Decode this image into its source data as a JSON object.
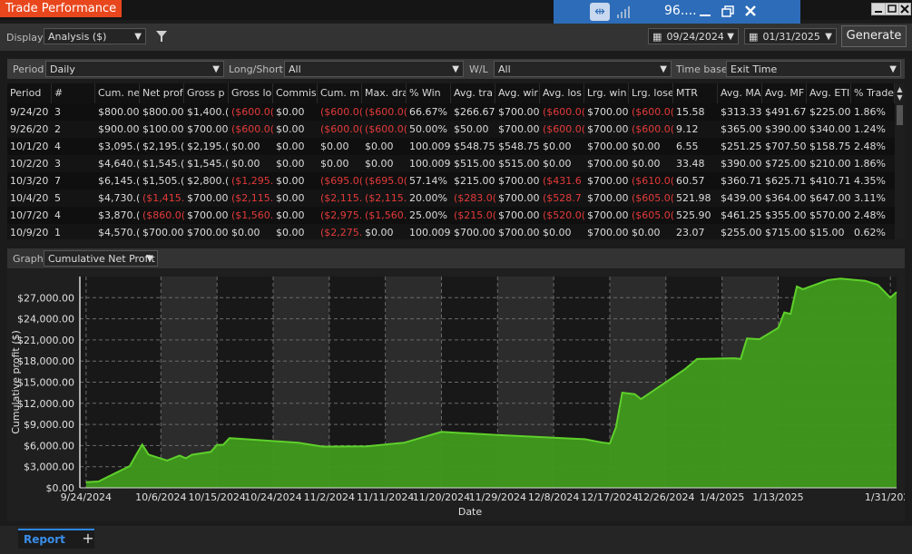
{
  "window": {
    "title": "Trade Performance"
  },
  "taskbar": {
    "label": "96...."
  },
  "toolbar": {
    "display_label": "Display",
    "display_value": "Analysis ($)",
    "start_date": "09/24/2024",
    "end_date": "01/31/2025",
    "generate_label": "Generate"
  },
  "filters": {
    "period_label": "Period",
    "period_value": "Daily",
    "longshort_label": "Long/Short",
    "longshort_value": "All",
    "wl_label": "W/L",
    "wl_value": "All",
    "timebase_label": "Time base",
    "timebase_value": "Exit Time"
  },
  "table": {
    "columns": [
      "Period",
      "#",
      "Cum. ne",
      "Net prof",
      "Gross p",
      "Gross lo",
      "Commis",
      "Cum. m",
      "Max. dra",
      "% Win",
      "Avg. tra",
      "Avg. wir",
      "Avg. los",
      "Lrg. win",
      "Lrg. lose",
      "MTR",
      "Avg. MA",
      "Avg. MF",
      "Avg. ETI",
      "% Trade"
    ],
    "rows": [
      [
        "9/24/20",
        "3",
        "$800.00",
        "$800.00",
        "$1,400.(",
        "($600.0(",
        "$0.00",
        "($600.0(",
        "($600.0(",
        "66.67%",
        "$266.67",
        "$700.00",
        "($600.0(",
        "$700.00",
        "($600.0(",
        "15.58",
        "$313.33",
        "$491.67",
        "$225.00",
        "1.86%"
      ],
      [
        "9/26/20",
        "2",
        "$900.00",
        "$100.00",
        "$700.00",
        "($600.0(",
        "$0.00",
        "($600.0(",
        "($600.0(",
        "50.00%",
        "$50.00",
        "$700.00",
        "($600.0(",
        "$700.00",
        "($600.0(",
        "9.12",
        "$365.00",
        "$390.00",
        "$340.00",
        "1.24%"
      ],
      [
        "10/1/20",
        "4",
        "$3,095.(",
        "$2,195.(",
        "$2,195.(",
        "$0.00",
        "$0.00",
        "$0.00",
        "$0.00",
        "100.009",
        "$548.75",
        "$548.75",
        "$0.00",
        "$700.00",
        "$0.00",
        "6.55",
        "$251.25",
        "$707.50",
        "$158.75",
        "2.48%"
      ],
      [
        "10/2/20",
        "3",
        "$4,640.(",
        "$1,545.(",
        "$1,545.(",
        "$0.00",
        "$0.00",
        "$0.00",
        "$0.00",
        "100.009",
        "$515.00",
        "$515.00",
        "$0.00",
        "$700.00",
        "$0.00",
        "33.48",
        "$390.00",
        "$725.00",
        "$210.00",
        "1.86%"
      ],
      [
        "10/3/20",
        "7",
        "$6,145.(",
        "$1,505.(",
        "$2,800.(",
        "($1,295.",
        "$0.00",
        "($695.0(",
        "($695.0(",
        "57.14%",
        "$215.00",
        "$700.00",
        "($431.6",
        "$700.00",
        "($610.0(",
        "60.57",
        "$360.71",
        "$625.71",
        "$410.71",
        "4.35%"
      ],
      [
        "10/4/20",
        "5",
        "$4,730.(",
        "($1,415.",
        "$700.00",
        "($2,115.",
        "$0.00",
        "($2,115.",
        "($2,115.",
        "20.00%",
        "($283.0(",
        "$700.00",
        "($528.7",
        "$700.00",
        "($605.0(",
        "521.98",
        "$439.00",
        "$364.00",
        "$647.00",
        "3.11%"
      ],
      [
        "10/7/20",
        "4",
        "$3,870.(",
        "($860.0(",
        "$700.00",
        "($1,560.",
        "$0.00",
        "($2,975.",
        "($1,560.",
        "25.00%",
        "($215.0(",
        "$700.00",
        "($520.0(",
        "$700.00",
        "($605.0(",
        "525.90",
        "$461.25",
        "$355.00",
        "$570.00",
        "2.48%"
      ],
      [
        "10/9/20",
        "1",
        "$4,570.(",
        "$700.00",
        "$700.00",
        "$0.00",
        "$0.00",
        "($2,275.",
        "$0.00",
        "100.009",
        "$700.00",
        "$700.00",
        "$0.00",
        "$700.00",
        "$0.00",
        "23.07",
        "$255.00",
        "$715.00",
        "$15.00",
        "0.62%"
      ]
    ]
  },
  "graph": {
    "label": "Graph",
    "type_value": "Cumulative Net Profit"
  },
  "chart_data": {
    "type": "area",
    "xlabel": "Date",
    "ylabel": "Cumulative profit ($)",
    "ylim": [
      0,
      30000
    ],
    "yticks": [
      0,
      3000,
      6000,
      9000,
      12000,
      15000,
      18000,
      21000,
      24000,
      27000
    ],
    "ytick_labels": [
      "$0.00",
      "$3,000.00",
      "$6,000.00",
      "$9,000.00",
      "$12,000.00",
      "$15,000.00",
      "$18,000.00",
      "$21,000.00",
      "$24,000.00",
      "$27,000.00"
    ],
    "xticks": [
      "2024-09-24",
      "2024-10-06",
      "2024-10-15",
      "2024-10-24",
      "2024-11-02",
      "2024-11-11",
      "2024-11-20",
      "2024-11-29",
      "2024-12-08",
      "2024-12-17",
      "2024-12-26",
      "2025-01-04",
      "2025-01-13",
      "2025-01-31"
    ],
    "xtick_labels": [
      "9/24/2024",
      "10/6/2024",
      "10/15/2024",
      "10/24/2024",
      "11/2/2024",
      "11/11/2024",
      "11/20/2024",
      "11/29/2024",
      "12/8/2024",
      "12/17/2024",
      "12/26/2024",
      "1/4/2025",
      "1/13/2025",
      "1/31/2025"
    ],
    "grid": true,
    "color": "#5fd02b",
    "points": [
      [
        "2024-09-24",
        800
      ],
      [
        "2024-09-26",
        900
      ],
      [
        "2024-10-01",
        3095
      ],
      [
        "2024-10-02",
        4640
      ],
      [
        "2024-10-03",
        6145
      ],
      [
        "2024-10-04",
        4730
      ],
      [
        "2024-10-07",
        3870
      ],
      [
        "2024-10-09",
        4570
      ],
      [
        "2024-10-10",
        4200
      ],
      [
        "2024-10-11",
        4700
      ],
      [
        "2024-10-14",
        5100
      ],
      [
        "2024-10-15",
        6100
      ],
      [
        "2024-10-16",
        6100
      ],
      [
        "2024-10-17",
        7050
      ],
      [
        "2024-10-28",
        6400
      ],
      [
        "2024-11-01",
        5850
      ],
      [
        "2024-11-08",
        5900
      ],
      [
        "2024-11-14",
        6400
      ],
      [
        "2024-11-20",
        7950
      ],
      [
        "2024-11-29",
        7500
      ],
      [
        "2024-12-13",
        6900
      ],
      [
        "2024-12-16",
        6400
      ],
      [
        "2024-12-17",
        6300
      ],
      [
        "2024-12-18",
        8600
      ],
      [
        "2024-12-19",
        13500
      ],
      [
        "2024-12-21",
        13300
      ],
      [
        "2024-12-22",
        12600
      ],
      [
        "2024-12-24",
        13800
      ],
      [
        "2024-12-29",
        16800
      ],
      [
        "2024-12-31",
        18300
      ],
      [
        "2025-01-06",
        18400
      ],
      [
        "2025-01-07",
        18300
      ],
      [
        "2025-01-08",
        21200
      ],
      [
        "2025-01-10",
        21100
      ],
      [
        "2025-01-13",
        22700
      ],
      [
        "2025-01-14",
        24900
      ],
      [
        "2025-01-15",
        24700
      ],
      [
        "2025-01-16",
        28600
      ],
      [
        "2025-01-17",
        28200
      ],
      [
        "2025-01-21",
        29500
      ],
      [
        "2025-01-23",
        29700
      ],
      [
        "2025-01-27",
        29400
      ],
      [
        "2025-01-29",
        28800
      ],
      [
        "2025-01-31",
        27000
      ],
      [
        "2025-02-01",
        27800
      ]
    ]
  },
  "bottom": {
    "tab_report": "Report",
    "add_tab": "+"
  }
}
